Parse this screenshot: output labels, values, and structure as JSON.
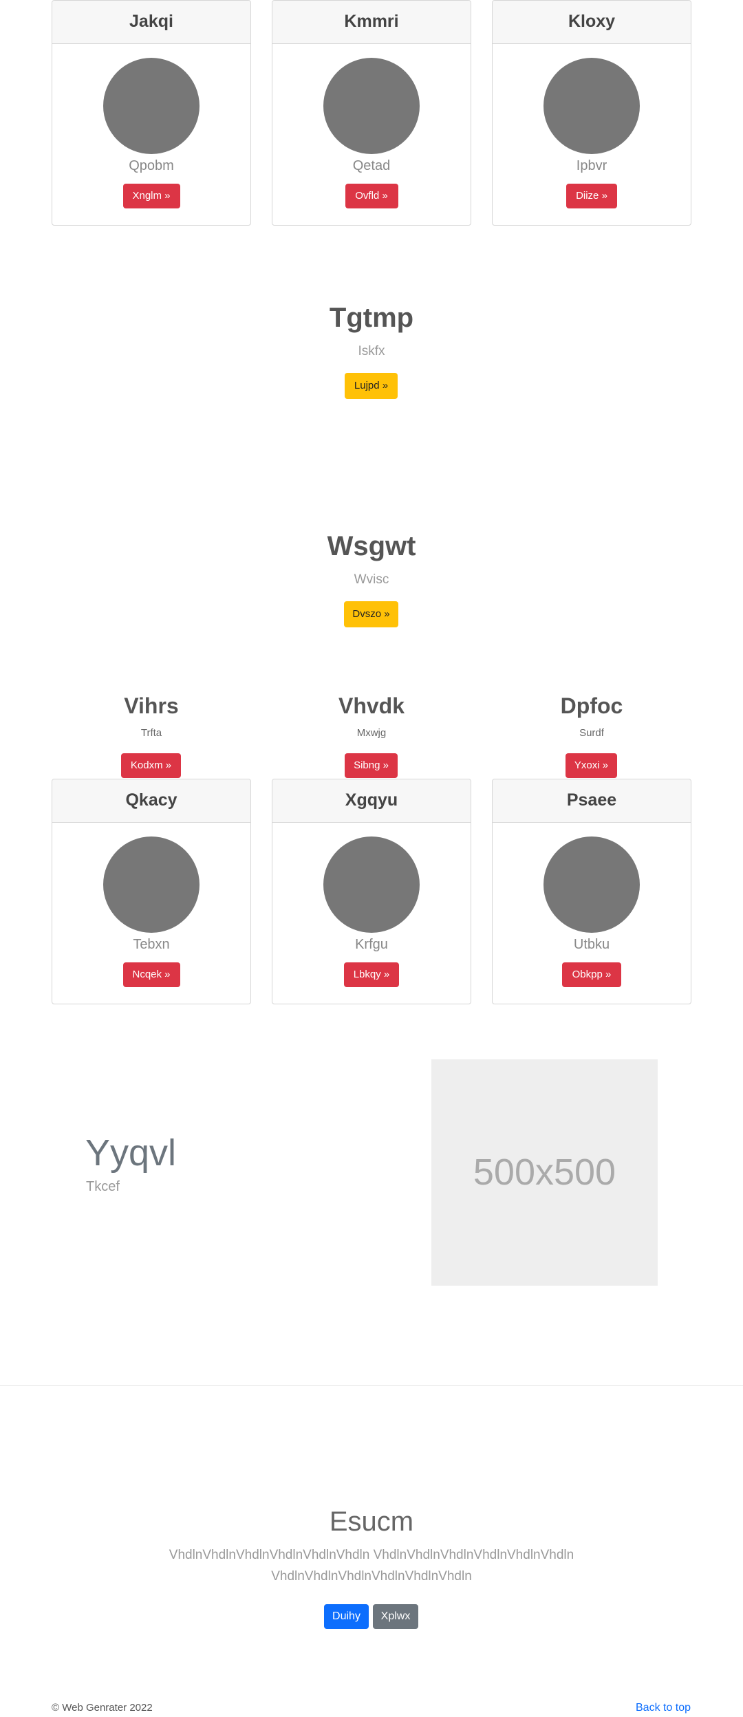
{
  "cards_row1": [
    {
      "header": "Jakqi",
      "label": "Qpobm",
      "button": "Xnglm »"
    },
    {
      "header": "Kmmri",
      "label": "Qetad",
      "button": "Ovfld »"
    },
    {
      "header": "Kloxy",
      "label": "Ipbvr",
      "button": "Diize »"
    }
  ],
  "hero1": {
    "title": "Tgtmp",
    "subtitle": "Iskfx",
    "button": "Lujpd »"
  },
  "hero2": {
    "title": "Wsgwt",
    "subtitle": "Wvisc",
    "button": "Dvszo »"
  },
  "columns": [
    {
      "title": "Vihrs",
      "subtitle": "Trfta",
      "button": "Kodxm »"
    },
    {
      "title": "Vhvdk",
      "subtitle": "Mxwjg",
      "button": "Sibng »"
    },
    {
      "title": "Dpfoc",
      "subtitle": "Surdf",
      "button": "Yxoxi »"
    }
  ],
  "cards_row2": [
    {
      "header": "Qkacy",
      "label": "Tebxn",
      "button": "Ncqek »"
    },
    {
      "header": "Xgqyu",
      "label": "Krfgu",
      "button": "Lbkqy »"
    },
    {
      "header": "Psaee",
      "label": "Utbku",
      "button": "Obkpp »"
    }
  ],
  "feature": {
    "title": "Yyqvl",
    "subtitle": "Tkcef",
    "image_text": "500x500"
  },
  "footer_cta": {
    "title": "Esucm",
    "line1": "VhdlnVhdlnVhdlnVhdlnVhdlnVhdln VhdlnVhdlnVhdlnVhdlnVhdlnVhdln",
    "line2": "VhdlnVhdlnVhdlnVhdlnVhdlnVhdln",
    "primary_button": "Duihy",
    "secondary_button": "Xplwx"
  },
  "footer": {
    "copyright": "© Web Genrater 2022",
    "back_to_top": "Back to top"
  },
  "colors": {
    "danger": "#dc3545",
    "warning": "#ffc107",
    "primary": "#0d6efd",
    "secondary": "#6c757d",
    "link": "#0d6efd"
  }
}
